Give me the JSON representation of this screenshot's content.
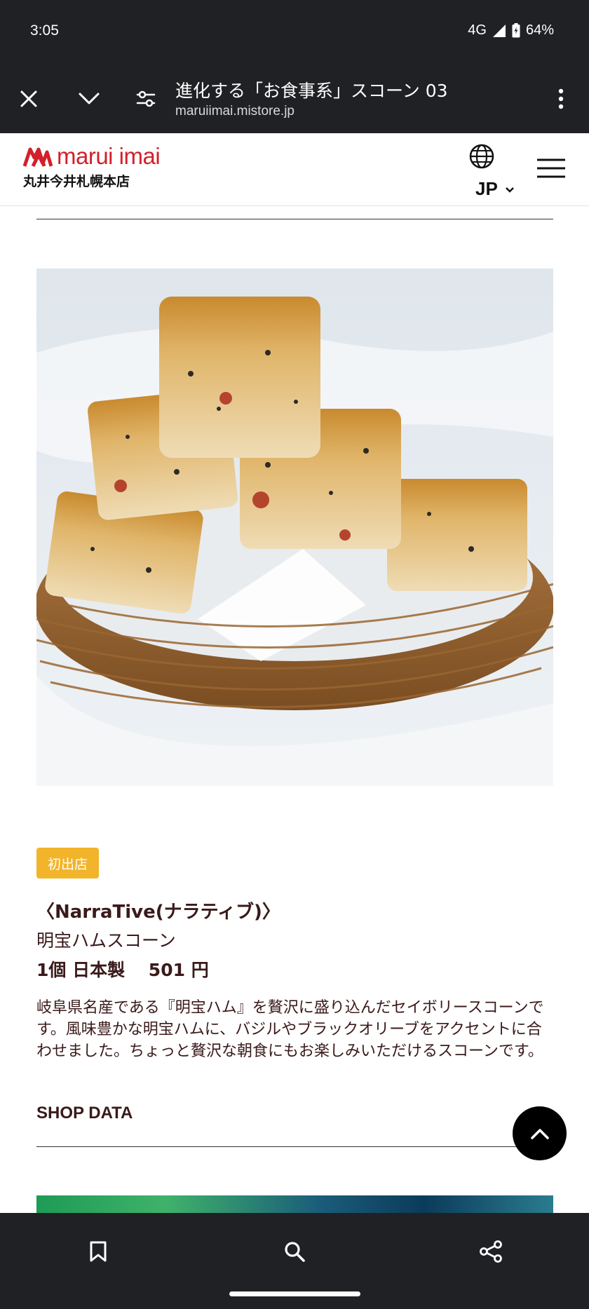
{
  "status_bar": {
    "time": "3:05",
    "network": "4G",
    "battery": "64%"
  },
  "tab_bar": {
    "title": "進化する「お食事系」スコーン 03",
    "url": "maruiimai.mistore.jp",
    "icons": [
      "close-icon",
      "chevron-down-icon",
      "page-settings-icon",
      "more-vert-icon"
    ]
  },
  "header": {
    "logo_text": "marui imai",
    "store_name": "丸井今井札幌本店",
    "language": "JP",
    "brand_color": "#d3202a"
  },
  "product": {
    "badge": "初出店",
    "badge_color": "#f2b42a",
    "brand": "〈NarraTive(ナラティブ)〉",
    "name": "明宝ハムスコーン",
    "price_line": "1個 日本製　 501 円",
    "description": "岐阜県名産である『明宝ハム』を贅沢に盛り込んだセイボリースコーンです。風味豊かな明宝ハムに、バジルやブラックオリーブをアクセントに合わせました。ちょっと贅沢な朝食にもお楽しみいただけるスコーンです。",
    "shop_data_label": "SHOP DATA"
  },
  "bottom_nav": {
    "icons": [
      "bookmark-icon",
      "search-icon",
      "share-icon"
    ]
  }
}
